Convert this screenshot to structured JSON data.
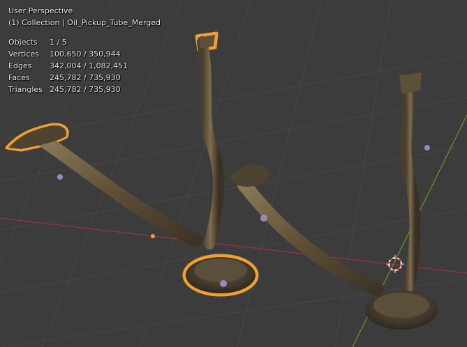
{
  "viewport": {
    "view_name": "User Perspective",
    "collection_line": "(1) Collection | Oil_Pickup_Tube_Merged"
  },
  "stats": [
    {
      "label": "Objects",
      "value": "1 / 5"
    },
    {
      "label": "Vertices",
      "value": "100,650 / 350,944"
    },
    {
      "label": "Edges",
      "value": "342,004 / 1,082,451"
    },
    {
      "label": "Faces",
      "value": "245,782 / 735,930"
    },
    {
      "label": "Triangles",
      "value": "245,782 / 735,930"
    }
  ],
  "colors": {
    "background": "#3c3c3c",
    "grid": "#454545",
    "x_axis": "#9a3340",
    "y_axis": "#6a9a2a",
    "selection_outline": "#f0a030",
    "metal": "#6b5a3e"
  },
  "icons": [
    "3d-cursor-icon",
    "object-origin-icon"
  ]
}
